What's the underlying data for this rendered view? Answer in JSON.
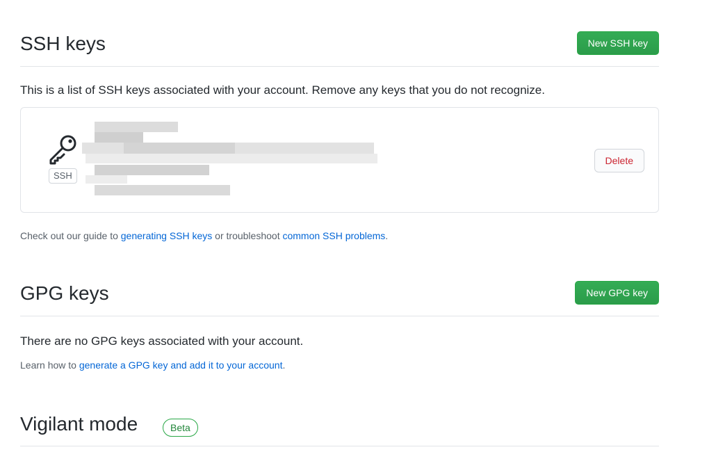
{
  "ssh_section": {
    "title": "SSH keys",
    "new_button": "New SSH key",
    "description": "This is a list of SSH keys associated with your account. Remove any keys that you do not recognize.",
    "key": {
      "type_label": "SSH",
      "delete_label": "Delete"
    },
    "help": {
      "prefix": "Check out our guide to ",
      "link1": "generating SSH keys",
      "middle": " or troubleshoot ",
      "link2": "common SSH problems",
      "suffix": "."
    }
  },
  "gpg_section": {
    "title": "GPG keys",
    "new_button": "New GPG key",
    "description": "There are no GPG keys associated with your account.",
    "help": {
      "prefix": "Learn how to ",
      "link": "generate a GPG key and add it to your account",
      "suffix": "."
    }
  },
  "vigilant_section": {
    "title": "Vigilant mode",
    "badge": "Beta"
  },
  "colors": {
    "primary_button": "#2ea44f",
    "link": "#0366d6",
    "danger": "#cb2431",
    "badge_green": "#22863a",
    "border": "#e1e4e8"
  }
}
